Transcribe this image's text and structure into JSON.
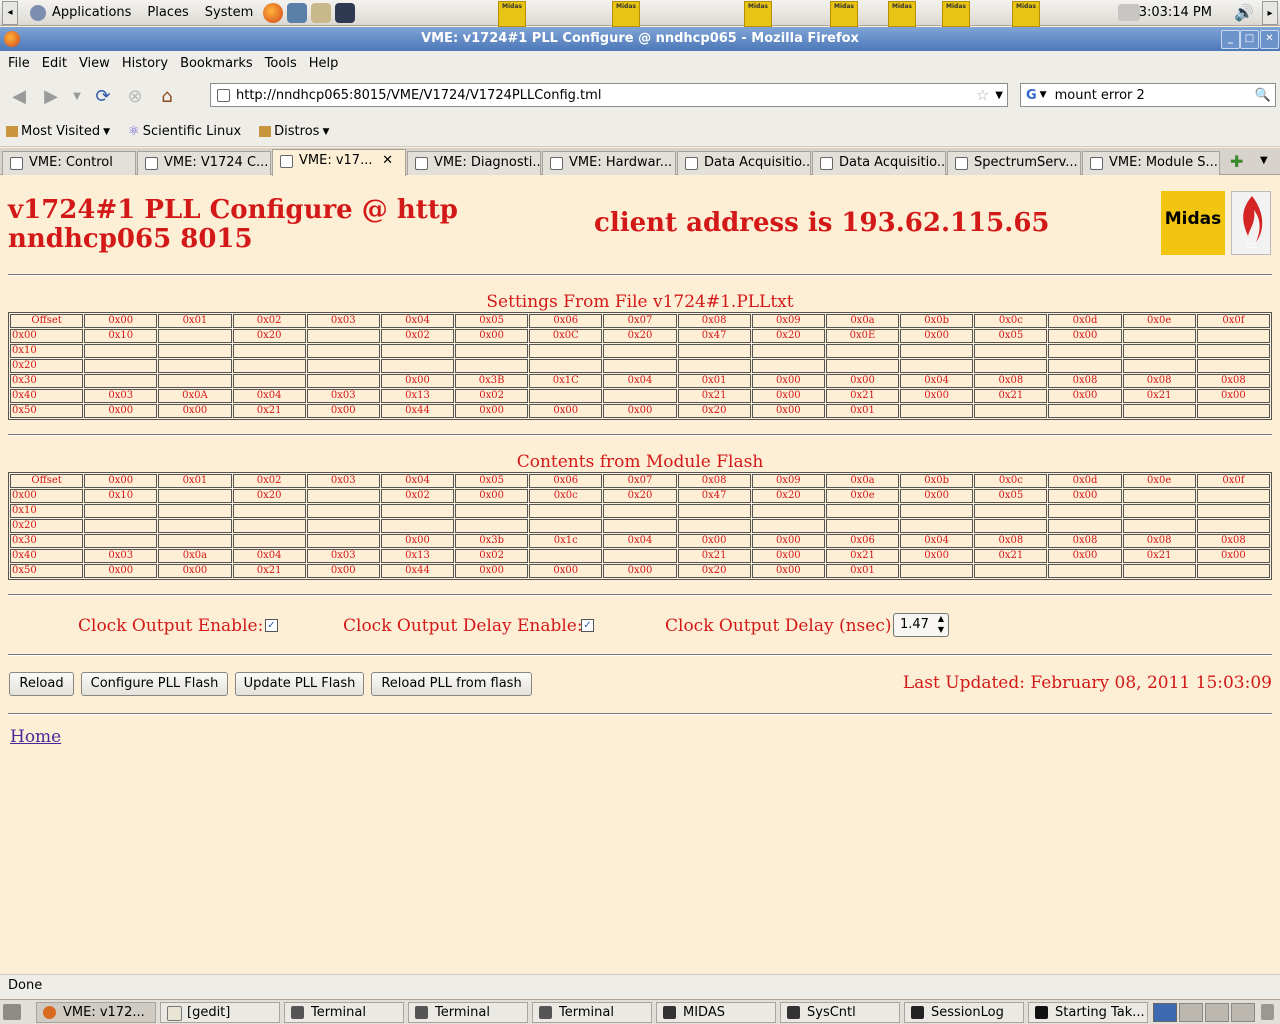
{
  "panel": {
    "menus": [
      "Applications",
      "Places",
      "System"
    ],
    "midas_applet_label": "Midas",
    "clock": "3:03:14 PM"
  },
  "window": {
    "title": "VME: v1724#1 PLL Configure @ nndhcp065 - Mozilla Firefox"
  },
  "menubar": [
    "File",
    "Edit",
    "View",
    "History",
    "Bookmarks",
    "Tools",
    "Help"
  ],
  "navbar": {
    "url": "http://nndhcp065:8015/VME/V1724/V1724PLLConfig.tml",
    "search": "mount error 2"
  },
  "bookmarks": [
    "Most Visited",
    "Scientific Linux",
    "Distros"
  ],
  "tabs": [
    "VME: Control",
    "VME: V1724 C...",
    "VME: v17...",
    "VME: Diagnosti...",
    "VME: Hardwar...",
    "Data Acquisitio...",
    "Data Acquisitio...",
    "SpectrumServ...",
    "VME: Module S..."
  ],
  "page": {
    "heading_line1": "v1724#1 PLL Configure @ http",
    "heading_line2": "nndhcp065 8015",
    "client_address": "client address is 193.62.115.65",
    "logo_midas": "Midas",
    "logo_tcl": "TCL",
    "file_table": {
      "caption": "Settings From File v1724#1.PLLtxt",
      "header": [
        "Offset",
        "0x00",
        "0x01",
        "0x02",
        "0x03",
        "0x04",
        "0x05",
        "0x06",
        "0x07",
        "0x08",
        "0x09",
        "0x0a",
        "0x0b",
        "0x0c",
        "0x0d",
        "0x0e",
        "0x0f"
      ],
      "rows": [
        [
          "0x00",
          "0x10",
          "",
          "0x20",
          "",
          "0x02",
          "0x00",
          "0x0C",
          "0x20",
          "0x47",
          "0x20",
          "0x0E",
          "0x00",
          "0x05",
          "0x00",
          "",
          ""
        ],
        [
          "0x10",
          "",
          "",
          "",
          "",
          "",
          "",
          "",
          "",
          "",
          "",
          "",
          "",
          "",
          "",
          "",
          ""
        ],
        [
          "0x20",
          "",
          "",
          "",
          "",
          "",
          "",
          "",
          "",
          "",
          "",
          "",
          "",
          "",
          "",
          "",
          ""
        ],
        [
          "0x30",
          "",
          "",
          "",
          "",
          "0x00",
          "0x3B",
          "0x1C",
          "0x04",
          "0x01",
          "0x00",
          "0x00",
          "0x04",
          "0x08",
          "0x08",
          "0x08",
          "0x08"
        ],
        [
          "0x40",
          "0x03",
          "0x0A",
          "0x04",
          "0x03",
          "0x13",
          "0x02",
          "",
          "",
          "0x21",
          "0x00",
          "0x21",
          "0x00",
          "0x21",
          "0x00",
          "0x21",
          "0x00"
        ],
        [
          "0x50",
          "0x00",
          "0x00",
          "0x21",
          "0x00",
          "0x44",
          "0x00",
          "0x00",
          "0x00",
          "0x20",
          "0x00",
          "0x01",
          "",
          "",
          "",
          "",
          ""
        ]
      ]
    },
    "flash_table": {
      "caption": "Contents from Module Flash",
      "header": [
        "Offset",
        "0x00",
        "0x01",
        "0x02",
        "0x03",
        "0x04",
        "0x05",
        "0x06",
        "0x07",
        "0x08",
        "0x09",
        "0x0a",
        "0x0b",
        "0x0c",
        "0x0d",
        "0x0e",
        "0x0f"
      ],
      "rows": [
        [
          "0x00",
          "0x10",
          "",
          "0x20",
          "",
          "0x02",
          "0x00",
          "0x0c",
          "0x20",
          "0x47",
          "0x20",
          "0x0e",
          "0x00",
          "0x05",
          "0x00",
          "",
          ""
        ],
        [
          "0x10",
          "",
          "",
          "",
          "",
          "",
          "",
          "",
          "",
          "",
          "",
          "",
          "",
          "",
          "",
          "",
          ""
        ],
        [
          "0x20",
          "",
          "",
          "",
          "",
          "",
          "",
          "",
          "",
          "",
          "",
          "",
          "",
          "",
          "",
          "",
          ""
        ],
        [
          "0x30",
          "",
          "",
          "",
          "",
          "0x00",
          "0x3b",
          "0x1c",
          "0x04",
          "0x00",
          "0x00",
          "0x06",
          "0x04",
          "0x08",
          "0x08",
          "0x08",
          "0x08"
        ],
        [
          "0x40",
          "0x03",
          "0x0a",
          "0x04",
          "0x03",
          "0x13",
          "0x02",
          "",
          "",
          "0x21",
          "0x00",
          "0x21",
          "0x00",
          "0x21",
          "0x00",
          "0x21",
          "0x00"
        ],
        [
          "0x50",
          "0x00",
          "0x00",
          "0x21",
          "0x00",
          "0x44",
          "0x00",
          "0x00",
          "0x00",
          "0x20",
          "0x00",
          "0x01",
          "",
          "",
          "",
          "",
          ""
        ]
      ]
    },
    "clock_output_enable_label": "Clock Output Enable:",
    "clock_output_delay_enable_label": "Clock Output Delay Enable:",
    "clock_output_delay_label": "Clock Output Delay (nsec):",
    "clock_output_delay_value": "1.47",
    "buttons": [
      "Reload",
      "Configure PLL Flash",
      "Update PLL Flash",
      "Reload PLL from flash"
    ],
    "last_updated": "Last Updated: February 08, 2011 15:03:09",
    "home_link": "Home"
  },
  "status": "Done",
  "taskbar": [
    "VME: v172...",
    "[gedit]",
    "Terminal",
    "Terminal",
    "Terminal",
    "MIDAS",
    "SysCntl",
    "SessionLog",
    "Starting Tak..."
  ],
  "colors": {
    "page_bg": "#fdefd6",
    "page_text": "#d31818",
    "titlebar": "#4d78b8"
  }
}
